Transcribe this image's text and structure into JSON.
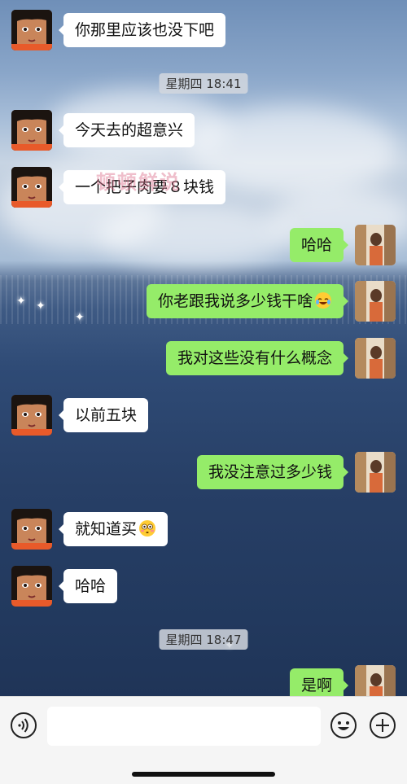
{
  "messages": [
    {
      "side": "in",
      "text": "你那里应该也没下吧"
    },
    {
      "timestamp": "星期四 18:41"
    },
    {
      "side": "in",
      "text": "今天去的超意兴"
    },
    {
      "side": "in",
      "text": "一个把子肉要８块钱"
    },
    {
      "side": "out",
      "text": "哈哈"
    },
    {
      "side": "out",
      "text": "你老跟我说多少钱干啥",
      "emoji": "laugh-cry-emoji"
    },
    {
      "side": "out",
      "text": "我对这些没有什么概念"
    },
    {
      "side": "in",
      "text": "以前五块"
    },
    {
      "side": "out",
      "text": "我没注意过多少钱"
    },
    {
      "side": "in",
      "text": "就知道买",
      "emoji": "flushed-emoji"
    },
    {
      "side": "in",
      "text": "哈哈"
    },
    {
      "timestamp": "星期四 18:47"
    },
    {
      "side": "out",
      "text": "是啊"
    }
  ],
  "watermark": "顿顿鲜说",
  "colors": {
    "incoming_bubble": "#ffffff",
    "outgoing_bubble": "#95ec69",
    "timestamp_bg": "#d2d7de"
  },
  "icons": {
    "voice": "voice-icon",
    "emoji": "emoji-icon",
    "more": "plus-icon"
  }
}
